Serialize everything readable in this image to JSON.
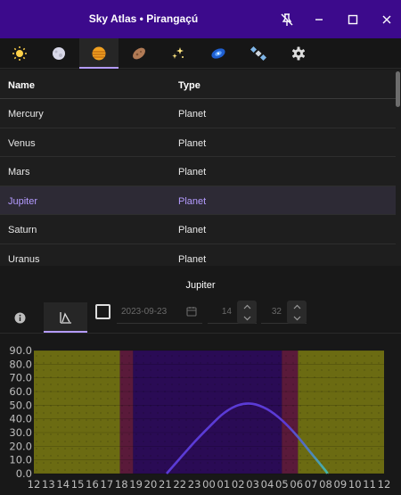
{
  "window": {
    "title": "Sky Atlas  •  Pirangaçú",
    "buttons": [
      "pin-off-icon",
      "minimize-icon",
      "maximize-icon",
      "close-icon"
    ]
  },
  "tabs": [
    {
      "icon": "sun-icon"
    },
    {
      "icon": "moon-icon"
    },
    {
      "icon": "planet-icon",
      "active": true
    },
    {
      "icon": "asteroid-icon"
    },
    {
      "icon": "stars-icon"
    },
    {
      "icon": "galaxy-icon"
    },
    {
      "icon": "satellite-icon"
    },
    {
      "icon": "gear-icon"
    }
  ],
  "table": {
    "columns": [
      "Name",
      "Type"
    ],
    "rows": [
      [
        "Mercury",
        "Planet"
      ],
      [
        "Venus",
        "Planet"
      ],
      [
        "Mars",
        "Planet"
      ],
      [
        "Jupiter",
        "Planet"
      ],
      [
        "Saturn",
        "Planet"
      ],
      [
        "Uranus",
        "Planet"
      ]
    ],
    "selected_index": 3
  },
  "detail": {
    "title": "Jupiter",
    "tabs": [
      {
        "icon": "info-icon"
      },
      {
        "icon": "altitude-chart-icon",
        "active": true
      }
    ],
    "now_checked": false,
    "date_value": "2023-09-23",
    "hour_value": "14",
    "minute_value": "32"
  },
  "colors": {
    "titlebar": "#3c0a8c",
    "accent": "#b49bff",
    "day": "#6b6b12",
    "twilight": "#5a1a3a",
    "night": "#2a0b55",
    "curve_start": "#5b3bd6",
    "curve_end": "#45b8a8"
  },
  "chart_data": {
    "type": "line",
    "title": "",
    "xlabel": "",
    "ylabel": "",
    "x_tick_labels": [
      "12",
      "13",
      "14",
      "15",
      "16",
      "17",
      "18",
      "19",
      "20",
      "21",
      "22",
      "23",
      "00",
      "01",
      "02",
      "03",
      "04",
      "05",
      "06",
      "07",
      "08",
      "09",
      "10",
      "11",
      "12"
    ],
    "y_tick_labels": [
      "90.0",
      "80.0",
      "70.0",
      "60.0",
      "50.0",
      "40.0",
      "30.0",
      "20.0",
      "10.0",
      "0.0"
    ],
    "ylim": [
      0,
      90
    ],
    "x_hours_since_noon_range": [
      0,
      24
    ],
    "series": [
      {
        "x": [
          9.1,
          10,
          11,
          12,
          13,
          14,
          15,
          16,
          17,
          18,
          19,
          20,
          20.1
        ],
        "y": [
          0,
          11,
          23,
          34,
          44,
          50,
          51,
          47,
          39,
          28,
          15,
          2,
          0
        ]
      }
    ],
    "bands": [
      {
        "from": 0,
        "to": 5.9,
        "kind": "day"
      },
      {
        "from": 5.9,
        "to": 6.8,
        "kind": "twilight"
      },
      {
        "from": 6.8,
        "to": 17.0,
        "kind": "night"
      },
      {
        "from": 17.0,
        "to": 18.1,
        "kind": "twilight"
      },
      {
        "from": 18.1,
        "to": 24,
        "kind": "day"
      }
    ],
    "grid": true
  }
}
